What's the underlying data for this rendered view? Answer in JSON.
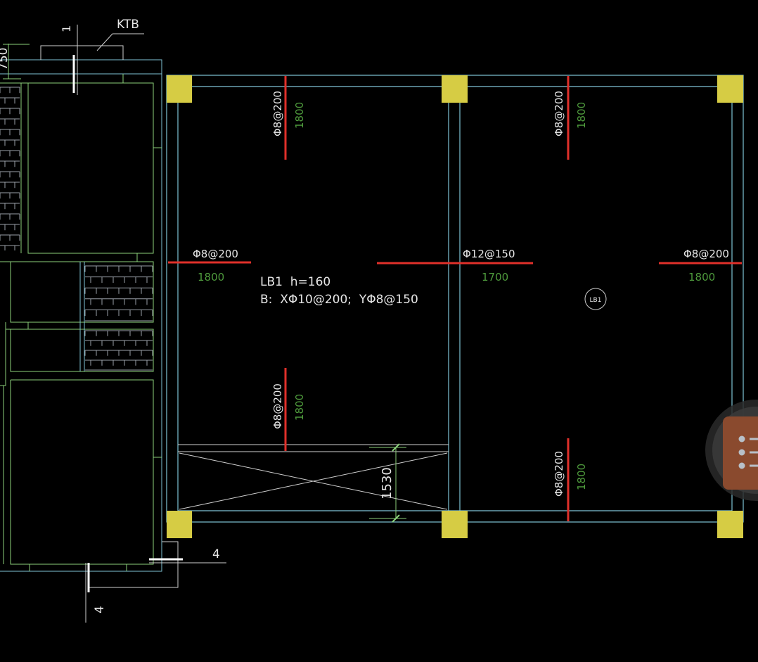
{
  "drawing": {
    "section_mark_top_number": "1",
    "section_mark_top_label": "KTB",
    "partial_dim_left": "750",
    "section_mark_bottom_number_h": "4",
    "section_mark_bottom_number_v": "4"
  },
  "slab": {
    "name_line": "LB1  h=160",
    "bottom_rebar_line": "B:  XΦ10@200;  YΦ8@150",
    "bubble_label": "LB1"
  },
  "rebar_labels": {
    "top_left_v_spec": "Φ8@200",
    "top_left_v_len": "1800",
    "top_right_v_spec": "Φ8@200",
    "top_right_v_len": "1800",
    "mid_left_h_spec": "Φ8@200",
    "mid_left_h_len": "1800",
    "mid_center_h_spec": "Φ12@150",
    "mid_center_h_len": "1700",
    "mid_right_h_spec": "Φ8@200",
    "mid_right_h_len": "1800",
    "bottom_left_v_spec": "Φ8@200",
    "bottom_left_v_len": "1800",
    "bottom_right_v_spec": "Φ8@200",
    "bottom_right_v_len": "1800"
  },
  "opening": {
    "dimension": "1530"
  },
  "colors": {
    "background": "#000000",
    "column": "#d6cc44",
    "beam_line": "#7fc4d6",
    "wall_line": "#8bd17a",
    "rebar": "#e0302a",
    "text_white": "#e6e6e6",
    "text_green": "#4e9a3c"
  },
  "icons": {
    "floating_tool": "list-icon"
  }
}
